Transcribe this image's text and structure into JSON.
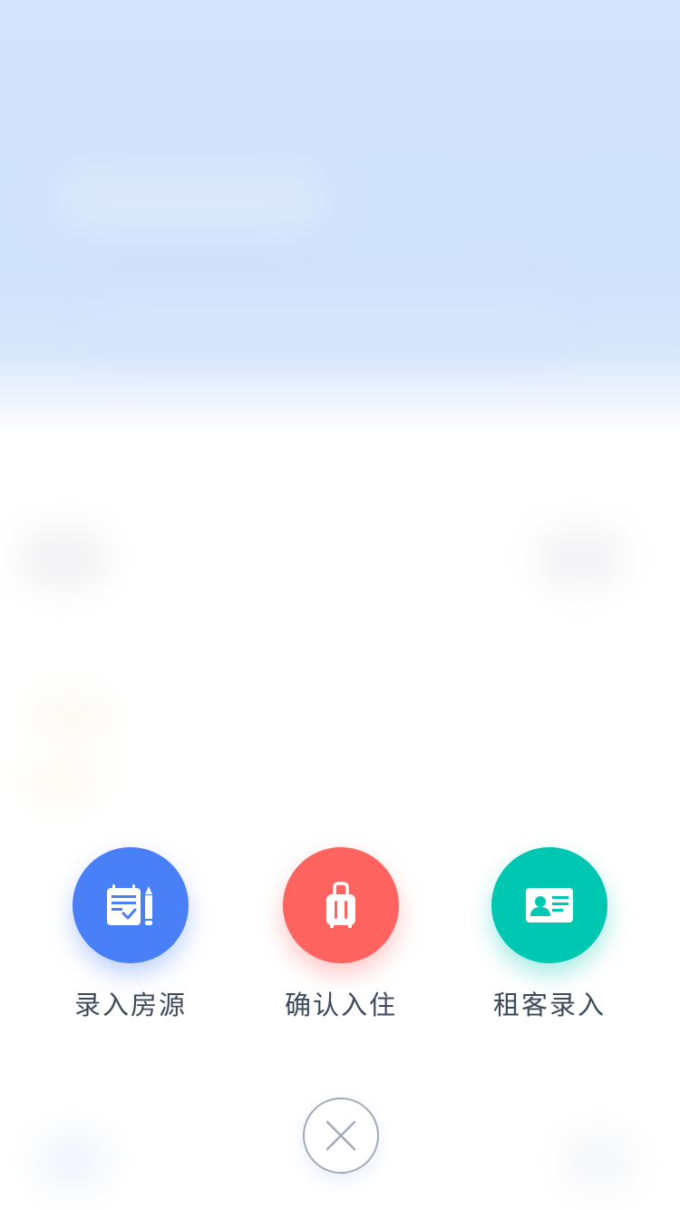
{
  "actions": [
    {
      "label": "录入房源",
      "icon": "notepad-pencil-icon",
      "color": "#4a80f7"
    },
    {
      "label": "确认入住",
      "icon": "luggage-icon",
      "color": "#ff6360"
    },
    {
      "label": "租客录入",
      "icon": "id-card-icon",
      "color": "#00c7b1"
    }
  ],
  "close": {
    "icon": "close-icon"
  },
  "colors": {
    "backdrop_top": "#d3e3fb",
    "label_text": "#3c4a5c",
    "close_border": "#a2aabb"
  }
}
